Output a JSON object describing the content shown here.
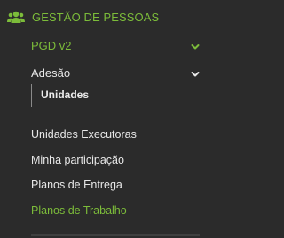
{
  "sidebar": {
    "section": {
      "label": "GESTÃO DE PESSOAS",
      "icon": "users-icon",
      "color": "#7cbc3a"
    },
    "pgd": {
      "label": "PGD v2",
      "icon": "chevron-down-icon",
      "expanded": true
    },
    "adesao": {
      "label": "Adesão",
      "icon": "chevron-down-icon",
      "expanded": true,
      "children": [
        {
          "label": "Unidades"
        }
      ]
    },
    "items": [
      {
        "label": "Unidades Executoras"
      },
      {
        "label": "Minha participação"
      },
      {
        "label": "Planos de Entrega"
      },
      {
        "label": "Planos de Trabalho",
        "active": true
      }
    ]
  },
  "colors": {
    "background": "#2b2b2b",
    "accent": "#7cbc3a",
    "text": "#e8e8e8"
  }
}
